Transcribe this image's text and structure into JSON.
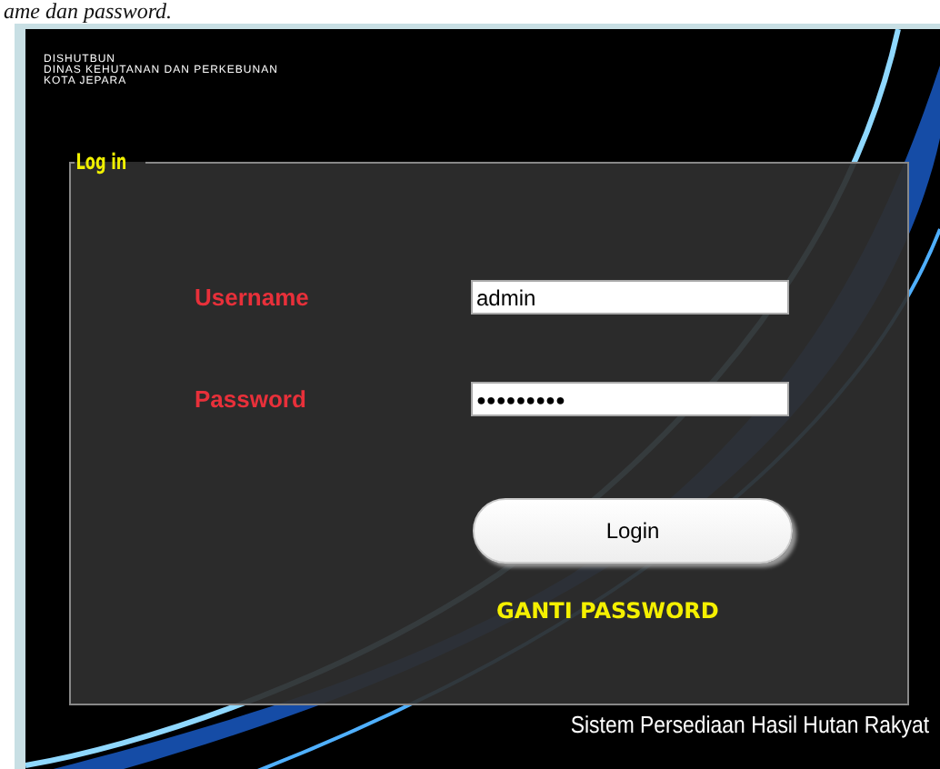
{
  "caption": "ame dan password.",
  "header": {
    "lines": [
      "DISHUTBUN",
      "DINAS KEHUTANAN DAN PERKEBUNAN",
      "KOTA JEPARA"
    ]
  },
  "login_group": {
    "title": "Log in",
    "fields": [
      {
        "label": "Username",
        "kind": "text",
        "value": "admin"
      },
      {
        "label": "Password",
        "kind": "password",
        "value": "●●●●●●●●●"
      }
    ],
    "button": "Login",
    "link": "GANTI PASSWORD"
  },
  "footer": "Sistem Persediaan Hasil Hutan Rakyat"
}
